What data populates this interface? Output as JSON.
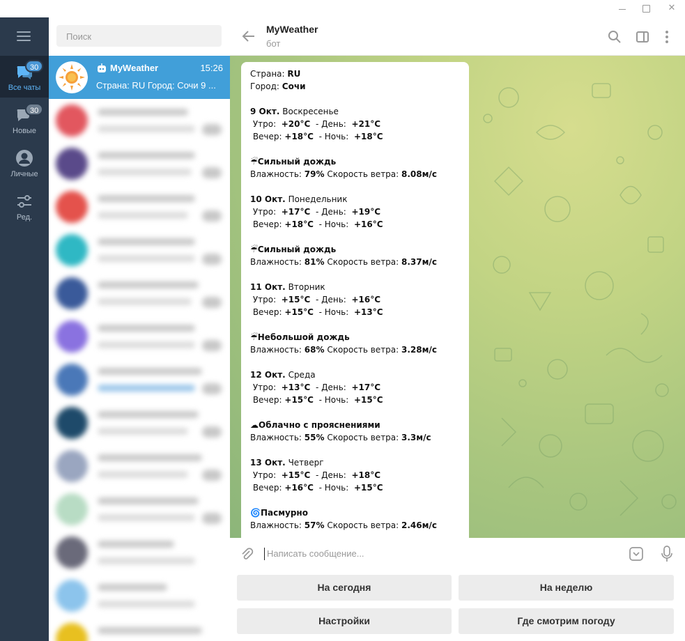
{
  "window": {
    "minimize_icon": "minimize-icon",
    "maximize_icon": "maximize-icon",
    "close_icon": "close-icon",
    "close_glyph": "✕"
  },
  "rail": {
    "menu_icon": "hamburger-menu-icon",
    "items": [
      {
        "label": "Все чаты",
        "badge": "30",
        "icon": "chats-icon",
        "active": true
      },
      {
        "label": "Новые",
        "badge": "30",
        "icon": "new-chat-icon",
        "active": false
      },
      {
        "label": "Личные",
        "badge": "",
        "icon": "person-icon",
        "active": false
      },
      {
        "label": "Ред.",
        "badge": "",
        "icon": "edit-filters-icon",
        "active": false
      }
    ]
  },
  "chatlist": {
    "search_placeholder": "Поиск",
    "active_chat": {
      "name": "MyWeather",
      "time": "15:26",
      "preview": "Страна: RU Город: Сочи  9 ..."
    }
  },
  "chat": {
    "title": "MyWeather",
    "subtitle": "бот",
    "actions": [
      "search-icon",
      "sidebar-toggle-icon",
      "more-vertical-icon"
    ],
    "message_lines": [
      {
        "t": "Страна: ",
        "b": "RU"
      },
      {
        "t": "Город: ",
        "b": "Сочи"
      },
      {
        "t": ""
      },
      {
        "b": "9 Окт.",
        "t2": " Воскресенье"
      },
      {
        "raw": " Утро:  <b>+20°C</b>  - День:  <b>+21°C</b>"
      },
      {
        "raw": " Вечер: <b>+18°C</b>  - Ночь:  <b>+18°C</b>"
      },
      {
        "t": ""
      },
      {
        "raw": "☔<b>Сильный дождь</b>"
      },
      {
        "raw": "Влажность: <b>79%</b> Скорость ветра: <b>8.08м/с</b>"
      },
      {
        "t": ""
      },
      {
        "b": "10 Окт.",
        "t2": " Понедельник"
      },
      {
        "raw": " Утро:  <b>+17°C</b>  - День:  <b>+19°C</b>"
      },
      {
        "raw": " Вечер: <b>+18°C</b>  - Ночь:  <b>+16°C</b>"
      },
      {
        "t": ""
      },
      {
        "raw": "☔<b>Сильный дождь</b>"
      },
      {
        "raw": "Влажность: <b>81%</b> Скорость ветра: <b>8.37м/с</b>"
      },
      {
        "t": ""
      },
      {
        "b": "11 Окт.",
        "t2": " Вторник"
      },
      {
        "raw": " Утро:  <b>+15°C</b>  - День:  <b>+16°C</b>"
      },
      {
        "raw": " Вечер: <b>+15°C</b>  - Ночь:  <b>+13°C</b>"
      },
      {
        "t": ""
      },
      {
        "raw": "☔<b>Небольшой дождь</b>"
      },
      {
        "raw": "Влажность: <b>68%</b> Скорость ветра: <b>3.28м/с</b>"
      },
      {
        "t": ""
      },
      {
        "b": "12 Окт.",
        "t2": " Среда"
      },
      {
        "raw": " Утро:  <b>+13°C</b>  - День:  <b>+17°C</b>"
      },
      {
        "raw": " Вечер: <b>+15°C</b>  - Ночь:  <b>+15°C</b>"
      },
      {
        "t": ""
      },
      {
        "raw": "☁<b>Облачно с прояснениями</b>"
      },
      {
        "raw": "Влажность: <b>55%</b> Скорость ветра: <b>3.3м/с</b>"
      },
      {
        "t": ""
      },
      {
        "b": "13 Окт.",
        "t2": " Четверг"
      },
      {
        "raw": " Утро:  <b>+15°C</b>  - День:  <b>+18°C</b>"
      },
      {
        "raw": " Вечер: <b>+16°C</b>  - Ночь:  <b>+15°C</b>"
      },
      {
        "t": ""
      },
      {
        "raw": "🌀<b>Пасмурно</b>"
      },
      {
        "raw": "Влажность: <b>57%</b> Скорость ветра: <b>2.46м/с</b>"
      }
    ]
  },
  "composer": {
    "placeholder": "Написать сообщение...",
    "attach_icon": "paperclip-icon",
    "commands_icon": "bot-commands-icon",
    "mic_icon": "microphone-icon"
  },
  "keyboard": {
    "today": "На сегодня",
    "week": "На неделю",
    "settings": "Настройки",
    "where": "Где смотрим погоду"
  },
  "colors": {
    "rail_bg": "#2b3a4c",
    "active_chat": "#419fd9",
    "accent": "#5eb5f7"
  }
}
